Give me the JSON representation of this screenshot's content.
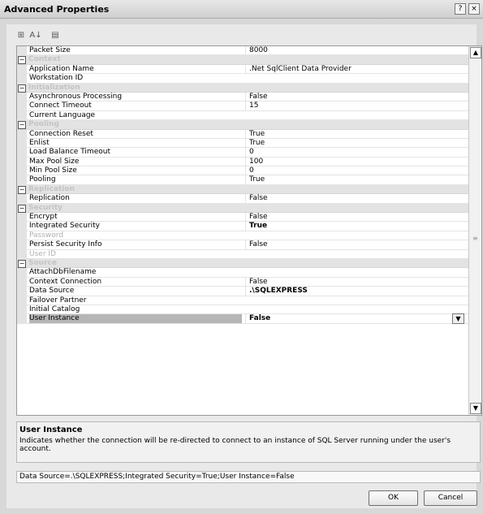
{
  "window": {
    "title": "Advanced Properties",
    "help_glyph": "?",
    "close_glyph": "×"
  },
  "toolbar": {
    "categorized_glyph": "⊞",
    "alphabetical_glyph": "A↓",
    "pages_glyph": "▤"
  },
  "properties": [
    {
      "type": "prop",
      "name": "Packet Size",
      "value": "8000"
    },
    {
      "type": "cat",
      "name": "Context"
    },
    {
      "type": "prop",
      "name": "Application Name",
      "value": ".Net SqlClient Data Provider"
    },
    {
      "type": "prop",
      "name": "Workstation ID",
      "value": ""
    },
    {
      "type": "cat",
      "name": "Initialization"
    },
    {
      "type": "prop",
      "name": "Asynchronous Processing",
      "value": "False"
    },
    {
      "type": "prop",
      "name": "Connect Timeout",
      "value": "15"
    },
    {
      "type": "prop",
      "name": "Current Language",
      "value": ""
    },
    {
      "type": "cat",
      "name": "Pooling"
    },
    {
      "type": "prop",
      "name": "Connection Reset",
      "value": "True"
    },
    {
      "type": "prop",
      "name": "Enlist",
      "value": "True"
    },
    {
      "type": "prop",
      "name": "Load Balance Timeout",
      "value": "0"
    },
    {
      "type": "prop",
      "name": "Max Pool Size",
      "value": "100"
    },
    {
      "type": "prop",
      "name": "Min Pool Size",
      "value": "0"
    },
    {
      "type": "prop",
      "name": "Pooling",
      "value": "True"
    },
    {
      "type": "cat",
      "name": "Replication"
    },
    {
      "type": "prop",
      "name": "Replication",
      "value": "False"
    },
    {
      "type": "cat",
      "name": "Security"
    },
    {
      "type": "prop",
      "name": "Encrypt",
      "value": "False"
    },
    {
      "type": "prop",
      "name": "Integrated Security",
      "value": "True",
      "bold": true
    },
    {
      "type": "prop",
      "name": "Password",
      "value": "",
      "disabled": true
    },
    {
      "type": "prop",
      "name": "Persist Security Info",
      "value": "False"
    },
    {
      "type": "prop",
      "name": "User ID",
      "value": "",
      "disabled": true
    },
    {
      "type": "cat",
      "name": "Source"
    },
    {
      "type": "prop",
      "name": "AttachDbFilename",
      "value": ""
    },
    {
      "type": "prop",
      "name": "Context Connection",
      "value": "False"
    },
    {
      "type": "prop",
      "name": "Data Source",
      "value": ".\\SQLEXPRESS",
      "bold": true
    },
    {
      "type": "prop",
      "name": "Failover Partner",
      "value": ""
    },
    {
      "type": "prop",
      "name": "Initial Catalog",
      "value": ""
    },
    {
      "type": "prop",
      "name": "User Instance",
      "value": "False",
      "bold": true,
      "selected": true
    }
  ],
  "scroll": {
    "up_glyph": "▲",
    "down_glyph": "▼",
    "grip_glyph": "≡"
  },
  "dropdown_glyph": "▼",
  "help": {
    "title": "User Instance",
    "description": "Indicates whether the connection will be re-directed to connect to an instance of SQL Server running under the user's account."
  },
  "connection_string": "Data Source=.\\SQLEXPRESS;Integrated Security=True;User Instance=False",
  "buttons": {
    "ok": "OK",
    "cancel": "Cancel"
  }
}
